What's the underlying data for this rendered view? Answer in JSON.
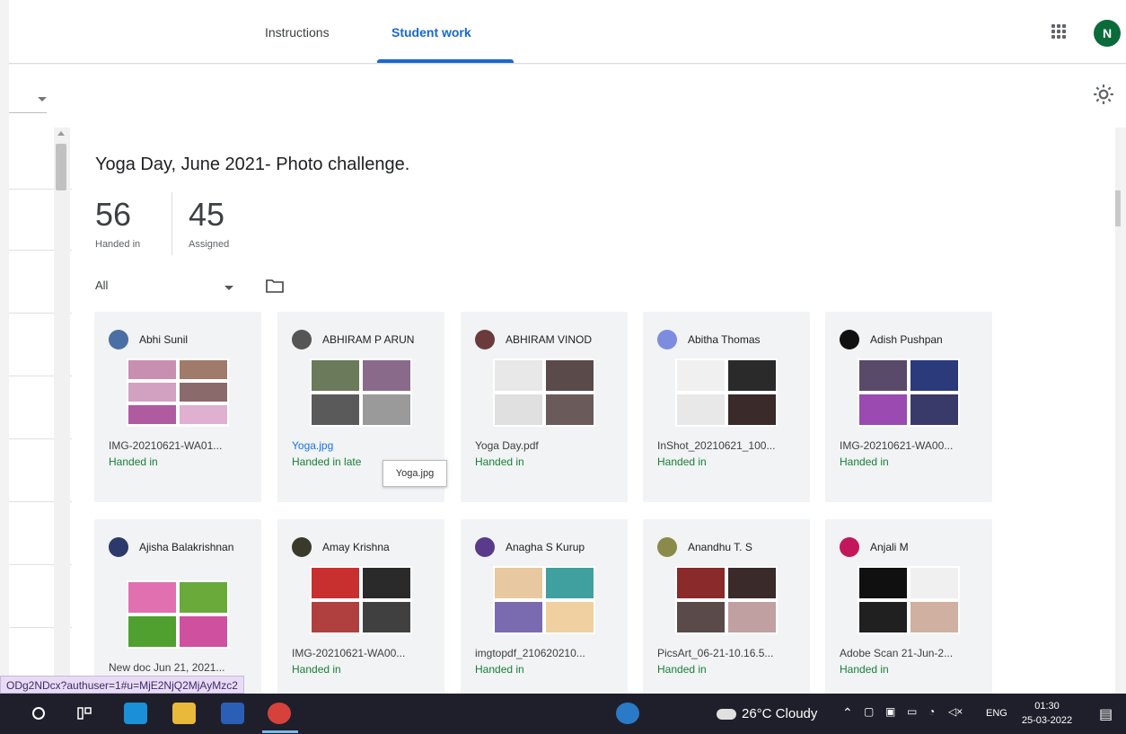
{
  "tabs": [
    {
      "label": "Instructions",
      "active": false
    },
    {
      "label": "Student work",
      "active": true
    }
  ],
  "account": {
    "initial": "N",
    "color": "#0b6b3a"
  },
  "assignment": {
    "title": "Yoga Day, June 2021- Photo challenge.",
    "handed_in_count": "56",
    "handed_in_label": "Handed in",
    "assigned_count": "45",
    "assigned_label": "Assigned"
  },
  "filter": {
    "value": "All"
  },
  "students": [
    {
      "name": "Abhi Sunil",
      "file": "IMG-20210621-WA01...",
      "status": "Handed in",
      "avatar_color": "#4a6fa5",
      "file_link": false
    },
    {
      "name": "ABHIRAM P ARUN",
      "file": "Yoga.jpg",
      "status": "Handed in late",
      "avatar_color": "#555555",
      "file_link": true
    },
    {
      "name": "ABHIRAM VINOD",
      "file": "Yoga Day.pdf",
      "status": "Handed in",
      "avatar_color": "#6b3b3b",
      "file_link": false
    },
    {
      "name": "Abitha Thomas",
      "file": "InShot_20210621_100...",
      "status": "Handed in",
      "avatar_color": "#7e8ce0",
      "file_link": false
    },
    {
      "name": "Adish Pushpan",
      "file": "IMG-20210621-WA00...",
      "status": "Handed in",
      "avatar_color": "#111111",
      "file_link": false
    },
    {
      "name": "Ajisha Balakrishnan",
      "file": "New doc Jun 21, 2021...",
      "status": "",
      "avatar_color": "#2b3a6b",
      "file_link": false
    },
    {
      "name": "Amay Krishna",
      "file": "IMG-20210621-WA00...",
      "status": "Handed in",
      "avatar_color": "#3a3a2a",
      "file_link": false
    },
    {
      "name": "Anagha S Kurup",
      "file": "imgtopdf_210620210...",
      "status": "Handed in",
      "avatar_color": "#5a3a8a",
      "file_link": false
    },
    {
      "name": "Anandhu T. S",
      "file": "PicsArt_06-21-10.16.5...",
      "status": "Handed in",
      "avatar_color": "#8a8a4a",
      "file_link": false
    },
    {
      "name": "Anjali M",
      "file": "Adobe Scan 21-Jun-2...",
      "status": "Handed in",
      "avatar_color": "#c2185b",
      "file_link": false
    }
  ],
  "tooltip": {
    "text": "Yoga.jpg"
  },
  "status_url": "ODg2NDcx?authuser=1#u=MjE2NjQ2MjAyMzc2",
  "taskbar": {
    "weather": "26°C  Cloudy",
    "language": "ENG",
    "time": "01:30",
    "date": "25-03-2022"
  },
  "colors": {
    "accent": "#1967d2",
    "handed_in": "#188038",
    "card_bg": "#f1f3f4"
  }
}
